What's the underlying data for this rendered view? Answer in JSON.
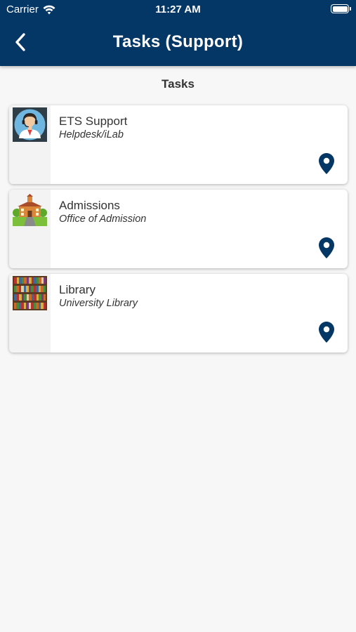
{
  "status_bar": {
    "carrier": "Carrier",
    "time": "11:27 AM"
  },
  "nav": {
    "title": "Tasks (Support)"
  },
  "section": {
    "title": "Tasks"
  },
  "tasks": [
    {
      "title": "ETS Support",
      "subtitle": "Helpdesk/iLab",
      "icon": "support-agent-icon"
    },
    {
      "title": "Admissions",
      "subtitle": "Office of Admission",
      "icon": "school-building-icon"
    },
    {
      "title": "Library",
      "subtitle": "University Library",
      "icon": "bookshelf-icon"
    }
  ],
  "colors": {
    "header": "#043666",
    "pin": "#043666",
    "background": "#f7f7f7"
  }
}
